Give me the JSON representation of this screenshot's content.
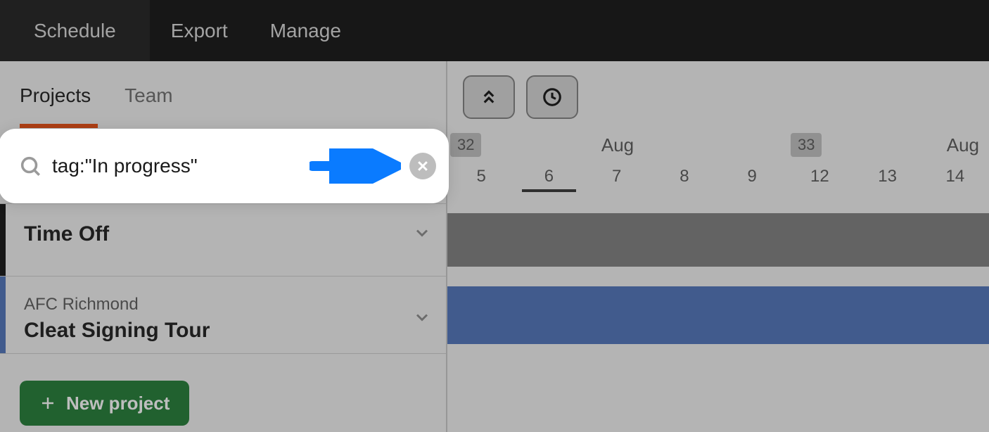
{
  "nav": {
    "tabs": [
      "Schedule",
      "Export",
      "Manage"
    ],
    "active": "Schedule"
  },
  "sidebar": {
    "tabs": [
      "Projects",
      "Team"
    ],
    "active": "Projects"
  },
  "search": {
    "value": "tag:\"In progress\""
  },
  "projects": [
    {
      "title": "Time Off",
      "accent_color": "#111111"
    },
    {
      "subtitle": "AFC Richmond",
      "title": "Cleat Signing Tour",
      "accent_color": "#4d72b9"
    }
  ],
  "buttons": {
    "new_project": "New project"
  },
  "timeline": {
    "weeks": [
      {
        "number": "32",
        "month": "Aug"
      },
      {
        "number": "33",
        "month": "Aug"
      }
    ],
    "days": [
      "5",
      "6",
      "7",
      "8",
      "9",
      "12",
      "13",
      "14"
    ],
    "today": "6"
  },
  "colors": {
    "accent_orange": "#e84a0c",
    "button_green": "#1f7a33",
    "bar_blue": "#4d72b9",
    "annotation_blue": "#0a7bff"
  }
}
